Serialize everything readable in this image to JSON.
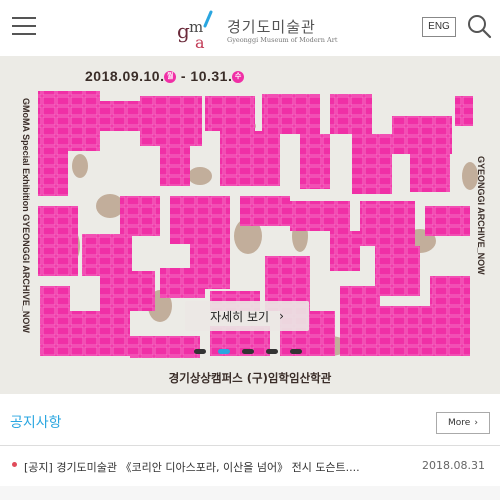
{
  "header": {
    "logo_name": "경기도미술관",
    "logo_sub": "Gyeonggi Museum of Modern Art",
    "logo_mark": "gma",
    "eng_label": "ENG",
    "icons": {
      "menu": "hamburger-menu-icon",
      "search": "search-icon"
    }
  },
  "banner": {
    "date_main": "2018.09.10.",
    "date_day1": "월",
    "date_sep": " - ",
    "date_end": "10.31.",
    "date_day2": "수",
    "left_vertical": "GMoMA Special Exhibition  GYEONGGI ARCHIVE_NOW",
    "right_vertical": "GYEONGGI ARCHIVE_NOW",
    "detail_label": "자세히 보기",
    "detail_chevron": "›",
    "venue": "경기상상캠퍼스 (구)임학임산학관",
    "slides_total": 5,
    "slide_active": 2,
    "accent": "#f02fa6"
  },
  "notice": {
    "title": "공지사항",
    "more_label": "More",
    "more_chevron": "›",
    "items": [
      {
        "text": "[공지] 경기도미술관 《코리안 디아스포라, 이산을 넘어》 전시 도슨트....",
        "date": "2018.08.31"
      }
    ]
  },
  "colors": {
    "accent_blue": "#2aa6e0",
    "bullet_red": "#e04b5a",
    "pink": "#f02fa6"
  }
}
